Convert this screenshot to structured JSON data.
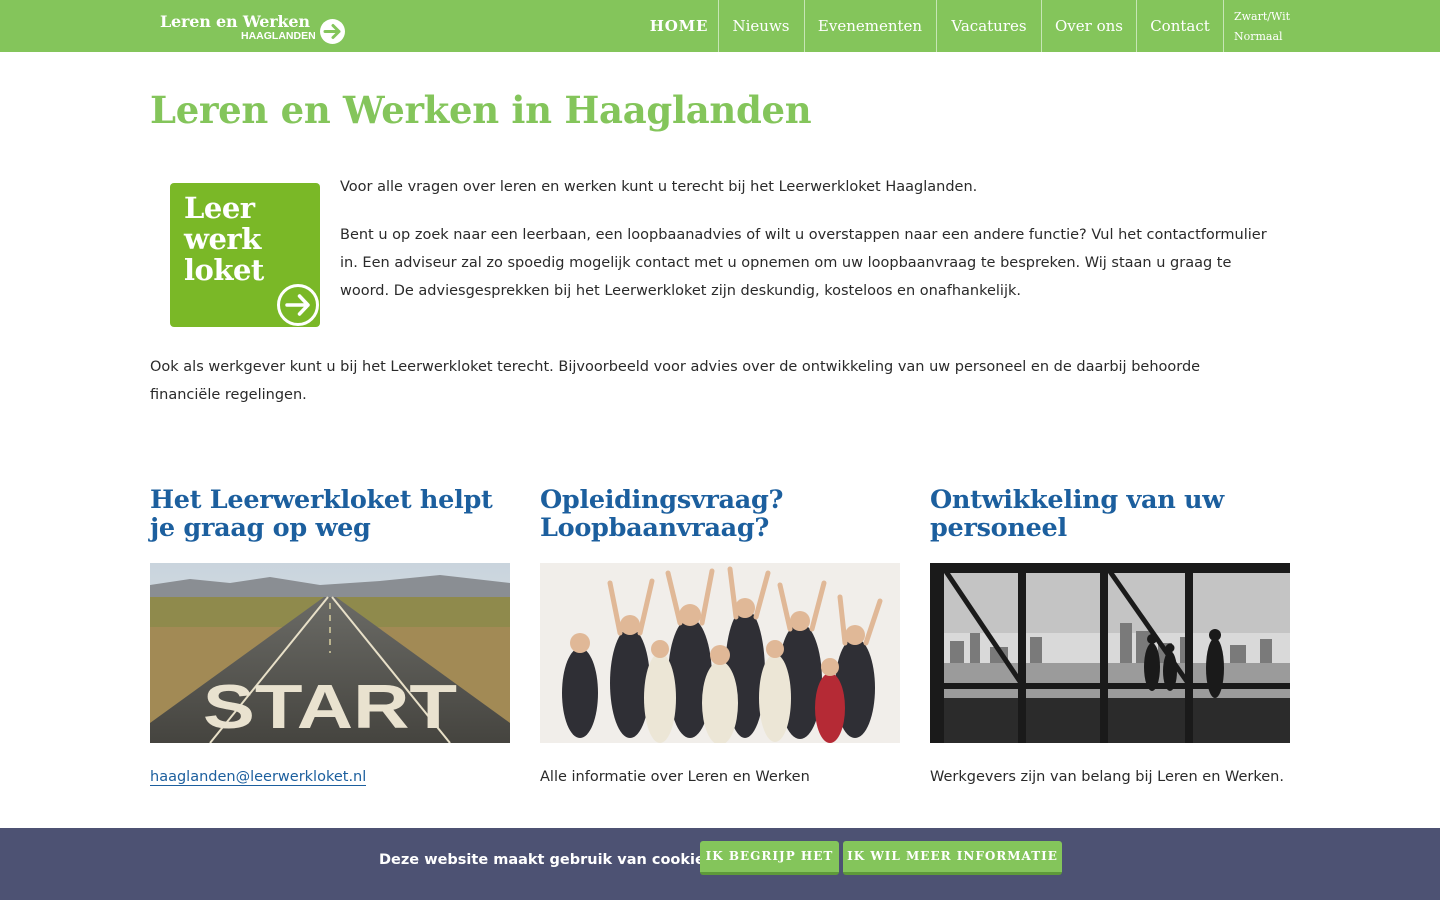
{
  "header": {
    "logo_title": "Leren en Werken",
    "logo_sub": "HAAGLANDEN",
    "nav": [
      "HOME",
      "Nieuws",
      "Evenementen",
      "Vacatures",
      "Over ons",
      "Contact"
    ],
    "contrast_options": [
      "Zwart/Wit",
      "Normaal"
    ]
  },
  "main": {
    "title": "Leren en Werken in Haaglanden",
    "loket_logo_lines": [
      "Leer",
      "werk",
      "loket"
    ],
    "intro_1": "Voor alle vragen over leren en werken kunt u terecht bij het Leerwerkloket Haaglanden.",
    "intro_2": "Bent u op zoek naar een leerbaan, een loopbaanadvies of wilt u overstappen naar een andere functie? Vul het contactformulier in. Een adviseur zal zo spoedig mogelijk contact met u opnemen om uw loopbaanvraag te bespreken. Wij staan u graag te woord. De adviesgesprekken bij het Leerwerkloket zijn deskundig, kosteloos en onafhankelijk.",
    "intro_3": "Ook als werkgever kunt u bij het Leerwerkloket terecht. Bijvoorbeeld voor advies over de ontwikkeling van uw personeel en de daarbij behoorde financiële regelingen."
  },
  "columns": [
    {
      "title": "Het Leerwerkloket helpt je graag op weg",
      "text": "haaglanden@leerwerkloket.nl"
    },
    {
      "title": "Opleidingsvraag? Loopbaanvraag?",
      "text": "Alle informatie over Leren en Werken"
    },
    {
      "title": "Ontwikkeling van uw personeel",
      "text": "Werkgevers zijn van belang bij Leren en Werken."
    }
  ],
  "cookie": {
    "message": "Deze website maakt gebruik van cookies",
    "accept": "IK BEGRIJP HET",
    "more": "IK WIL MEER INFORMATIE"
  },
  "colors": {
    "brand_green": "#84c55b",
    "logo_green": "#7ab827",
    "link_blue": "#1c5f9e",
    "cookie_bg": "#4d5273"
  }
}
